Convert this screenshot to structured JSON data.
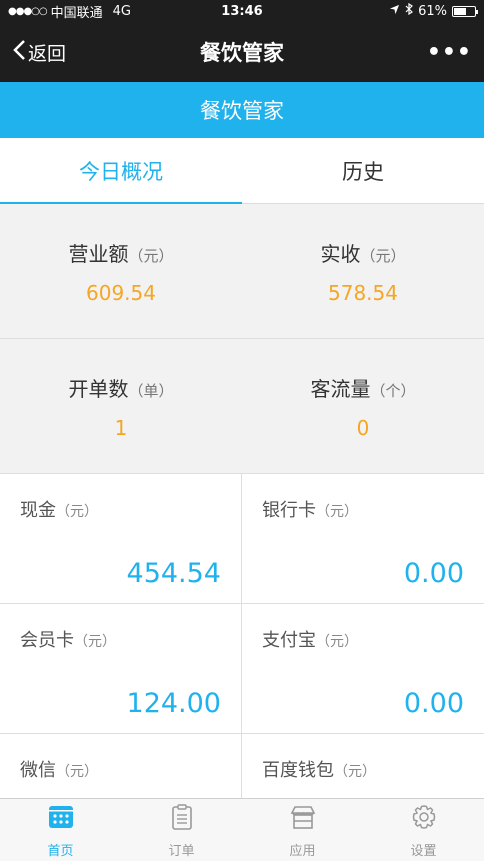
{
  "status_bar": {
    "signal": "●●●○○",
    "carrier": "中国联通",
    "network": "4G",
    "time": "13:46",
    "battery": "61%",
    "battery_level": 0.61
  },
  "nav": {
    "back_label": "返回",
    "title": "餐饮管家",
    "more": "•••"
  },
  "app_header": {
    "title": "餐饮管家"
  },
  "tabs": [
    {
      "label": "今日概况",
      "active": true
    },
    {
      "label": "历史",
      "active": false
    }
  ],
  "summary": {
    "revenue": {
      "label": "营业额",
      "unit": "（元）",
      "value": "609.54"
    },
    "received": {
      "label": "实收",
      "unit": "（元）",
      "value": "578.54"
    },
    "orders": {
      "label": "开单数",
      "unit": "（单）",
      "value": "1"
    },
    "customers": {
      "label": "客流量",
      "unit": "（个）",
      "value": "0"
    }
  },
  "payments": {
    "cash": {
      "label": "现金",
      "unit": "（元）",
      "value": "454.54"
    },
    "bank_card": {
      "label": "银行卡",
      "unit": "（元）",
      "value": "0.00"
    },
    "member_card": {
      "label": "会员卡",
      "unit": "（元）",
      "value": "124.00"
    },
    "alipay": {
      "label": "支付宝",
      "unit": "（元）",
      "value": "0.00"
    },
    "wechat": {
      "label": "微信",
      "unit": "（元）"
    },
    "baidu_wallet": {
      "label": "百度钱包",
      "unit": "（元）"
    }
  },
  "bottom_tabs": [
    {
      "label": "首页",
      "icon": "home-grid-icon",
      "active": true
    },
    {
      "label": "订单",
      "icon": "clipboard-icon",
      "active": false
    },
    {
      "label": "应用",
      "icon": "store-icon",
      "active": false
    },
    {
      "label": "设置",
      "icon": "gear-icon",
      "active": false
    }
  ],
  "colors": {
    "accent": "#20b2ec",
    "value_orange": "#f5a623",
    "bar_dark": "#1e1e1e"
  }
}
